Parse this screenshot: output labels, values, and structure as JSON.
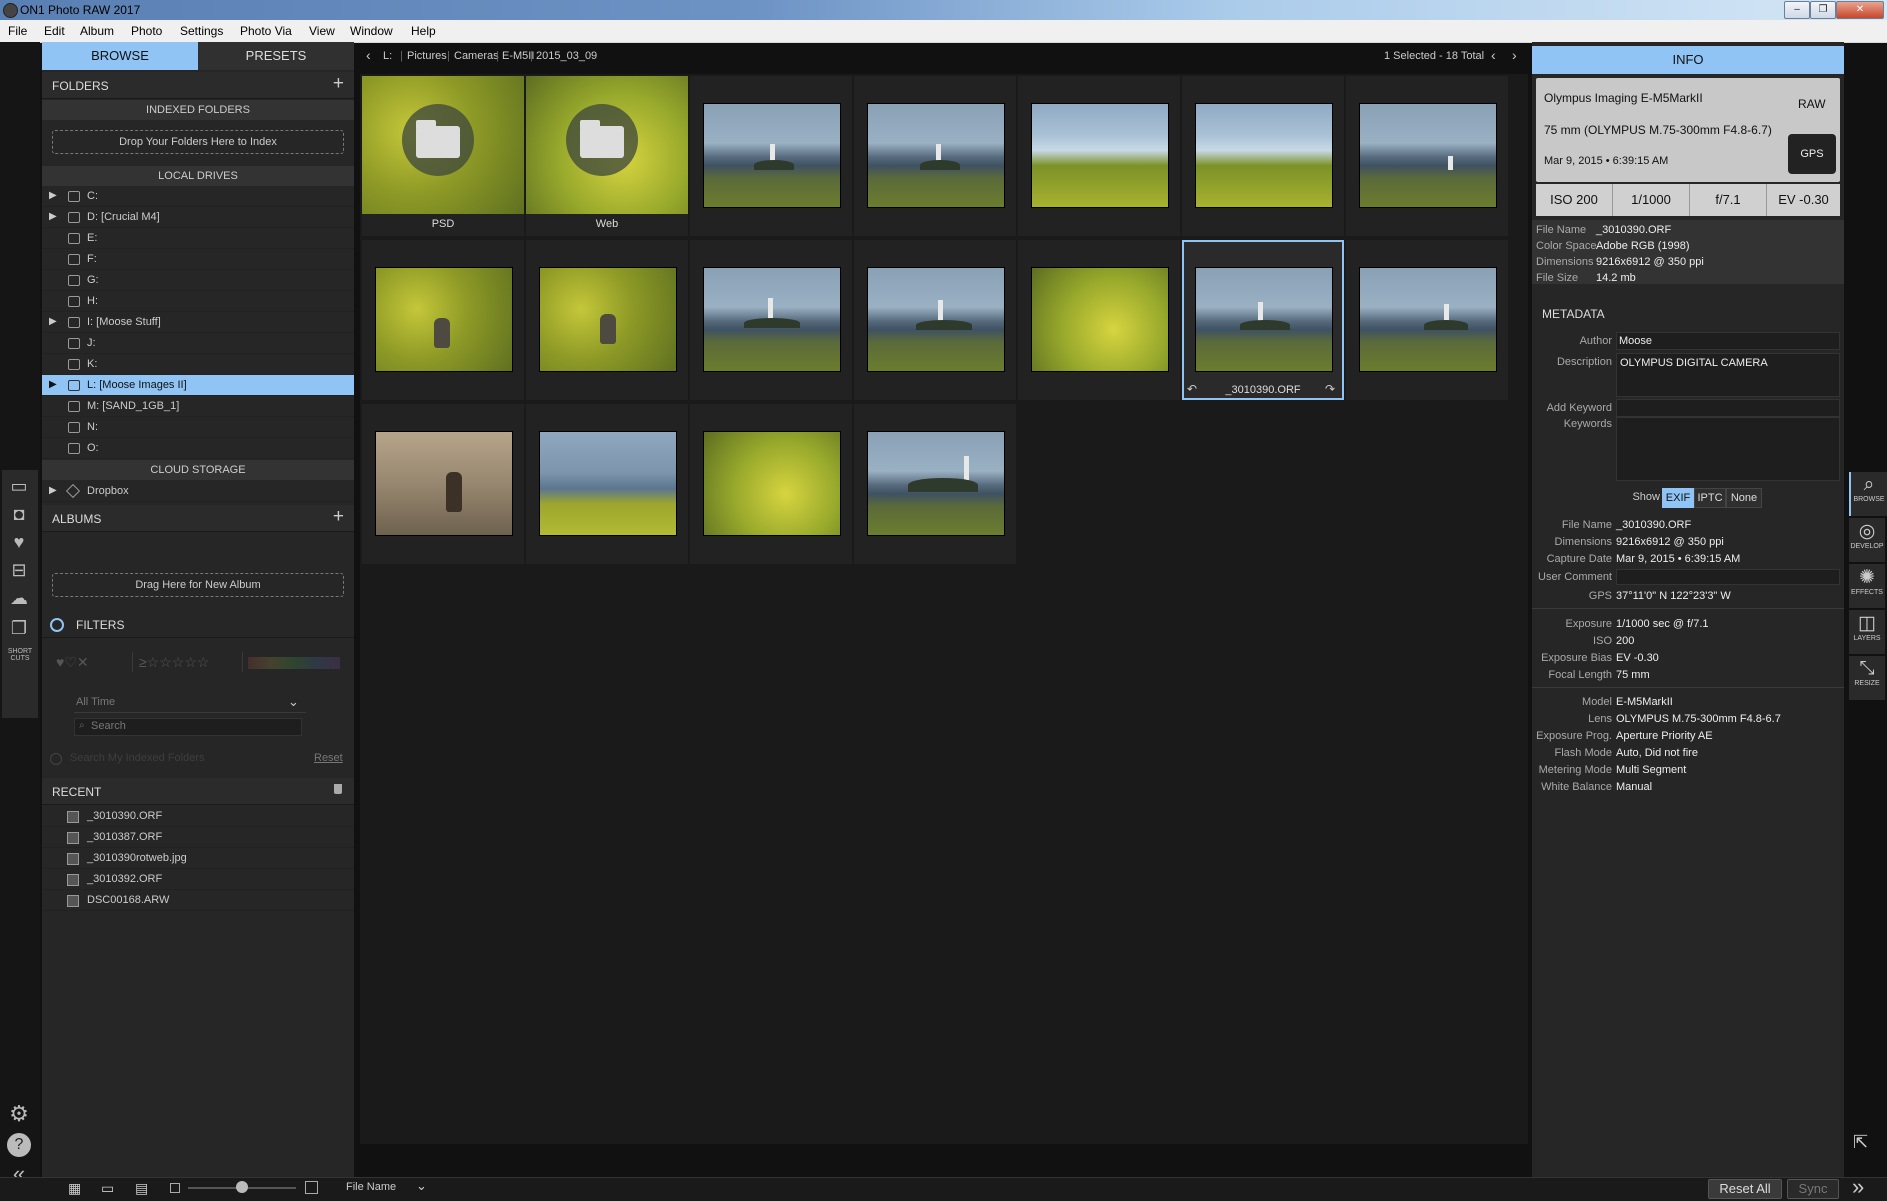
{
  "window": {
    "title": "ON1 Photo RAW 2017",
    "minimize": "–",
    "restore": "❐",
    "close": "✕"
  },
  "menu": [
    "File",
    "Edit",
    "Album",
    "Photo",
    "Settings",
    "Photo Via",
    "View",
    "Window",
    "Help"
  ],
  "left_tabs": {
    "browse": "BROWSE",
    "presets": "PRESETS"
  },
  "folders": {
    "title": "FOLDERS",
    "indexed_title": "INDEXED FOLDERS",
    "indexed_drop": "Drop Your Folders Here to Index",
    "local_title": "LOCAL DRIVES",
    "drives": [
      {
        "name": "C:",
        "arrow": "▶"
      },
      {
        "name": "D: [Crucial M4]",
        "arrow": "▶"
      },
      {
        "name": "E:",
        "arrow": ""
      },
      {
        "name": "F:",
        "arrow": ""
      },
      {
        "name": "G:",
        "arrow": ""
      },
      {
        "name": "H:",
        "arrow": ""
      },
      {
        "name": "I: [Moose Stuff]",
        "arrow": "▶"
      },
      {
        "name": "J:",
        "arrow": ""
      },
      {
        "name": "K:",
        "arrow": ""
      },
      {
        "name": "L: [Moose Images II]",
        "arrow": "▶"
      },
      {
        "name": "M: [SAND_1GB_1]",
        "arrow": ""
      },
      {
        "name": "N:",
        "arrow": ""
      },
      {
        "name": "O:",
        "arrow": ""
      }
    ],
    "cloud_title": "CLOUD STORAGE",
    "cloud_items": [
      {
        "name": "Dropbox",
        "arrow": "▶"
      }
    ]
  },
  "albums": {
    "title": "ALBUMS",
    "drop": "Drag Here for New Album"
  },
  "filters": {
    "title": "FILTERS",
    "rating": "≥☆☆☆☆☆",
    "hearts": "♥♡✕",
    "time": "All Time",
    "search_placeholder": "Search",
    "search_indexed": "Search My Indexed Folders",
    "reset": "Reset"
  },
  "recent": {
    "title": "RECENT",
    "items": [
      "_3010390.ORF",
      "_3010387.ORF",
      "_3010390rotweb.jpg",
      "_3010392.ORF",
      "DSC00168.ARW"
    ]
  },
  "left_rail": {
    "shortcuts": "SHORT CUTS"
  },
  "path": {
    "crumbs": [
      "L:",
      "Pictures",
      "Cameras",
      "E-M5II",
      "2015_03_09"
    ],
    "selection": "1 Selected - 18 Total"
  },
  "grid": {
    "folders": [
      "PSD",
      "Web"
    ],
    "selected_caption": "_3010390.ORF"
  },
  "info": {
    "title": "INFO",
    "camera": "Olympus Imaging E-M5MarkII",
    "lens": "75 mm (OLYMPUS M.75-300mm F4.8-6.7)",
    "date": "Mar 9, 2015 • 6:39:15 AM",
    "raw": "RAW",
    "gps": "GPS",
    "exposure": [
      "ISO 200",
      "1/1000",
      "f/7.1",
      "EV -0.30"
    ],
    "file": [
      {
        "label": "File Name",
        "value": "_3010390.ORF"
      },
      {
        "label": "Color Space",
        "value": "Adobe RGB (1998)"
      },
      {
        "label": "Dimensions",
        "value": "9216x6912 @ 350 ppi"
      },
      {
        "label": "File Size",
        "value": "14.2 mb"
      }
    ]
  },
  "metadata": {
    "title": "METADATA",
    "author_label": "Author",
    "author": "Moose",
    "description_label": "Description",
    "description": "OLYMPUS DIGITAL CAMERA",
    "add_keyword_label": "Add Keyword",
    "keywords_label": "Keywords",
    "show_label": "Show",
    "show_options": [
      "EXIF",
      "IPTC",
      "None"
    ],
    "group1": [
      {
        "label": "File Name",
        "value": "_3010390.ORF"
      },
      {
        "label": "Dimensions",
        "value": "9216x6912 @ 350 ppi"
      },
      {
        "label": "Capture Date",
        "value": "Mar 9, 2015 • 6:39:15 AM"
      },
      {
        "label": "User Comment",
        "value": ""
      },
      {
        "label": "GPS",
        "value": "37°11'0\" N 122°23'3\" W"
      }
    ],
    "group2": [
      {
        "label": "Exposure",
        "value": "1/1000 sec @ f/7.1"
      },
      {
        "label": "ISO",
        "value": "200"
      },
      {
        "label": "Exposure Bias",
        "value": "EV -0.30"
      },
      {
        "label": "Focal Length",
        "value": "75 mm"
      }
    ],
    "group3": [
      {
        "label": "Model",
        "value": "E-M5MarkII"
      },
      {
        "label": "Lens",
        "value": "OLYMPUS M.75-300mm F4.8-6.7"
      },
      {
        "label": "Exposure Prog.",
        "value": "Aperture Priority AE"
      },
      {
        "label": "Flash Mode",
        "value": "Auto, Did not fire"
      },
      {
        "label": "Metering Mode",
        "value": "Multi Segment"
      },
      {
        "label": "White Balance",
        "value": "Manual"
      }
    ]
  },
  "modules": [
    {
      "label": "BROWSE",
      "icon": "browse-icon"
    },
    {
      "label": "DEVELOP",
      "icon": "develop-icon"
    },
    {
      "label": "EFFECTS",
      "icon": "effects-icon"
    },
    {
      "label": "LAYERS",
      "icon": "layers-icon"
    },
    {
      "label": "RESIZE",
      "icon": "resize-icon"
    }
  ],
  "bottom": {
    "sort": "File Name",
    "reset_all": "Reset All",
    "sync": "Sync",
    "thumb_size": 0.5
  }
}
